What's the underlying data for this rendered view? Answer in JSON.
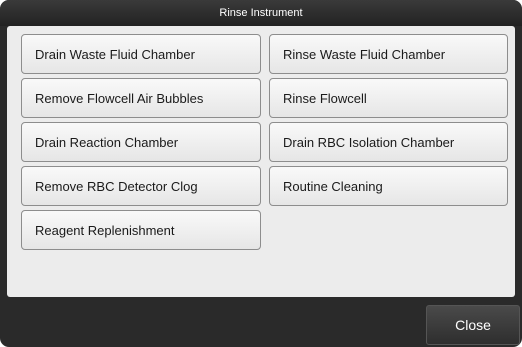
{
  "dialog": {
    "title": "Rinse Instrument",
    "close_label": "Close"
  },
  "buttons": [
    "Drain Waste Fluid Chamber",
    "Rinse Waste Fluid Chamber",
    "Remove Flowcell Air Bubbles",
    "Rinse Flowcell",
    "Drain Reaction Chamber",
    "Drain RBC Isolation Chamber",
    "Remove RBC Detector Clog",
    "Routine Cleaning",
    "Reagent Replenishment"
  ]
}
